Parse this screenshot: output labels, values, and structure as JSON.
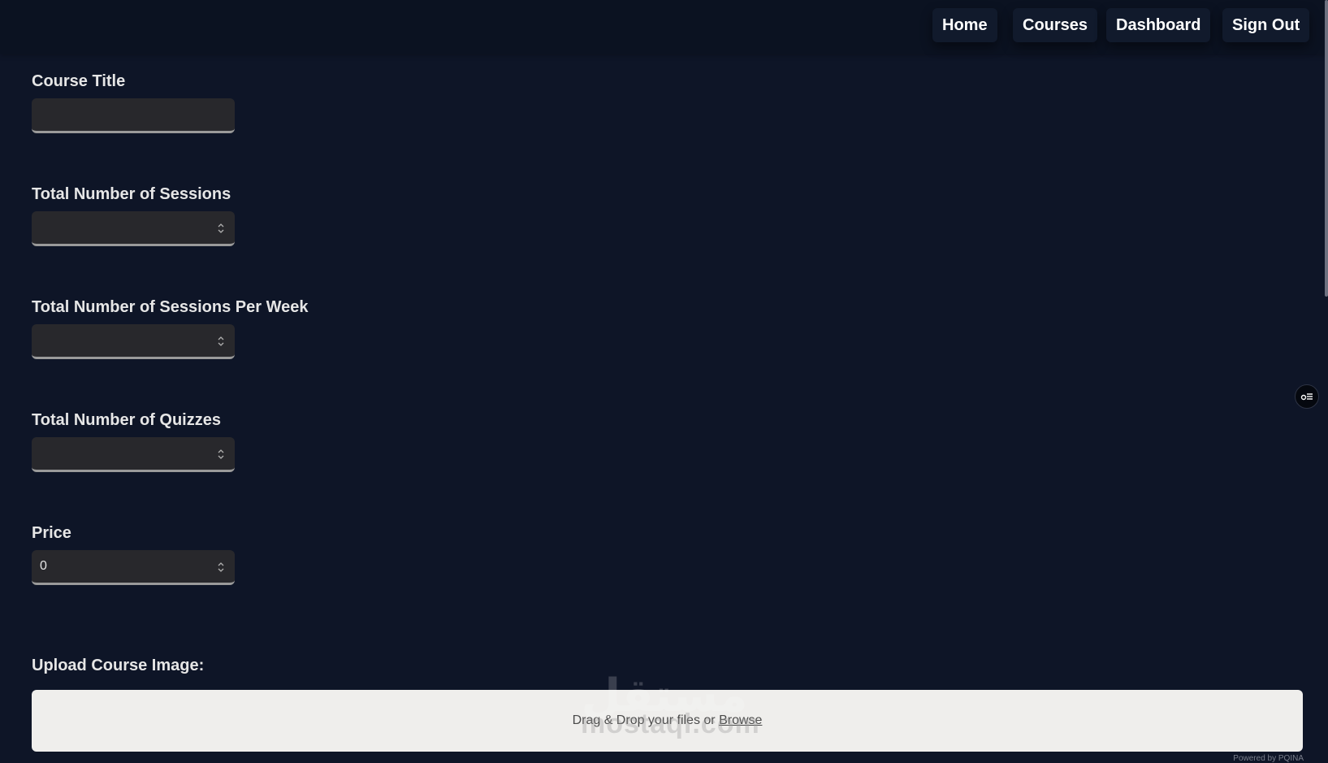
{
  "nav": {
    "home": "Home",
    "courses": "Courses",
    "dashboard": "Dashboard",
    "sign_out": "Sign Out"
  },
  "form": {
    "course_title": {
      "label": "Course Title",
      "value": ""
    },
    "total_sessions": {
      "label": "Total Number of Sessions",
      "value": ""
    },
    "sessions_per_week": {
      "label": "Total Number of Sessions Per Week",
      "value": ""
    },
    "total_quizzes": {
      "label": "Total Number of Quizzes",
      "value": ""
    },
    "price": {
      "label": "Price",
      "value": "0"
    },
    "upload": {
      "label": "Upload Course Image:",
      "dropzone_text": "Drag & Drop your files or ",
      "browse": "Browse"
    }
  },
  "watermark": {
    "arabic": "مستقل",
    "latin": "mostaql.com"
  },
  "powered_by": "Powered by PQINA",
  "icons": {
    "spinner": "up-down-chevron-icon",
    "side_widget": "list-settings-icon"
  },
  "colors": {
    "background": "#0e1527",
    "navbar": "#0b1221",
    "input_bg": "#28282c",
    "dropzone_bg": "#efeeec"
  }
}
